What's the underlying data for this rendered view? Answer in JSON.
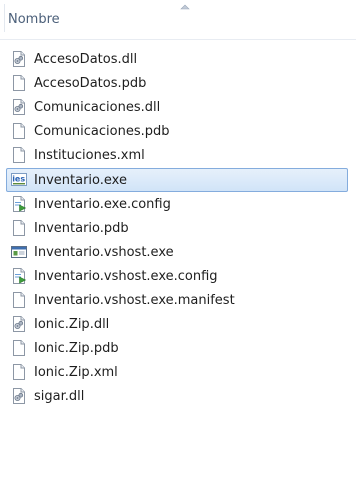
{
  "header": {
    "column_name": "Nombre",
    "sort_direction": "ascending"
  },
  "files": [
    {
      "name": "AccesoDatos.dll",
      "icon": "dll-icon"
    },
    {
      "name": "AccesoDatos.pdb",
      "icon": "blank-file-icon"
    },
    {
      "name": "Comunicaciones.dll",
      "icon": "dll-icon"
    },
    {
      "name": "Comunicaciones.pdb",
      "icon": "blank-file-icon"
    },
    {
      "name": "Instituciones.xml",
      "icon": "blank-file-icon"
    },
    {
      "name": "Inventario.exe",
      "icon": "app-exe-icon",
      "selected": true
    },
    {
      "name": "Inventario.exe.config",
      "icon": "config-file-icon"
    },
    {
      "name": "Inventario.pdb",
      "icon": "blank-file-icon"
    },
    {
      "name": "Inventario.vshost.exe",
      "icon": "window-exe-icon"
    },
    {
      "name": "Inventario.vshost.exe.config",
      "icon": "config-file-icon"
    },
    {
      "name": "Inventario.vshost.exe.manifest",
      "icon": "blank-file-icon"
    },
    {
      "name": "Ionic.Zip.dll",
      "icon": "dll-icon"
    },
    {
      "name": "Ionic.Zip.pdb",
      "icon": "blank-file-icon"
    },
    {
      "name": "Ionic.Zip.xml",
      "icon": "blank-file-icon"
    },
    {
      "name": "sigar.dll",
      "icon": "dll-icon"
    }
  ],
  "colors": {
    "header_text": "#4c607a",
    "selection_fill": "#d9e8f9",
    "selection_border": "#84acdd"
  }
}
